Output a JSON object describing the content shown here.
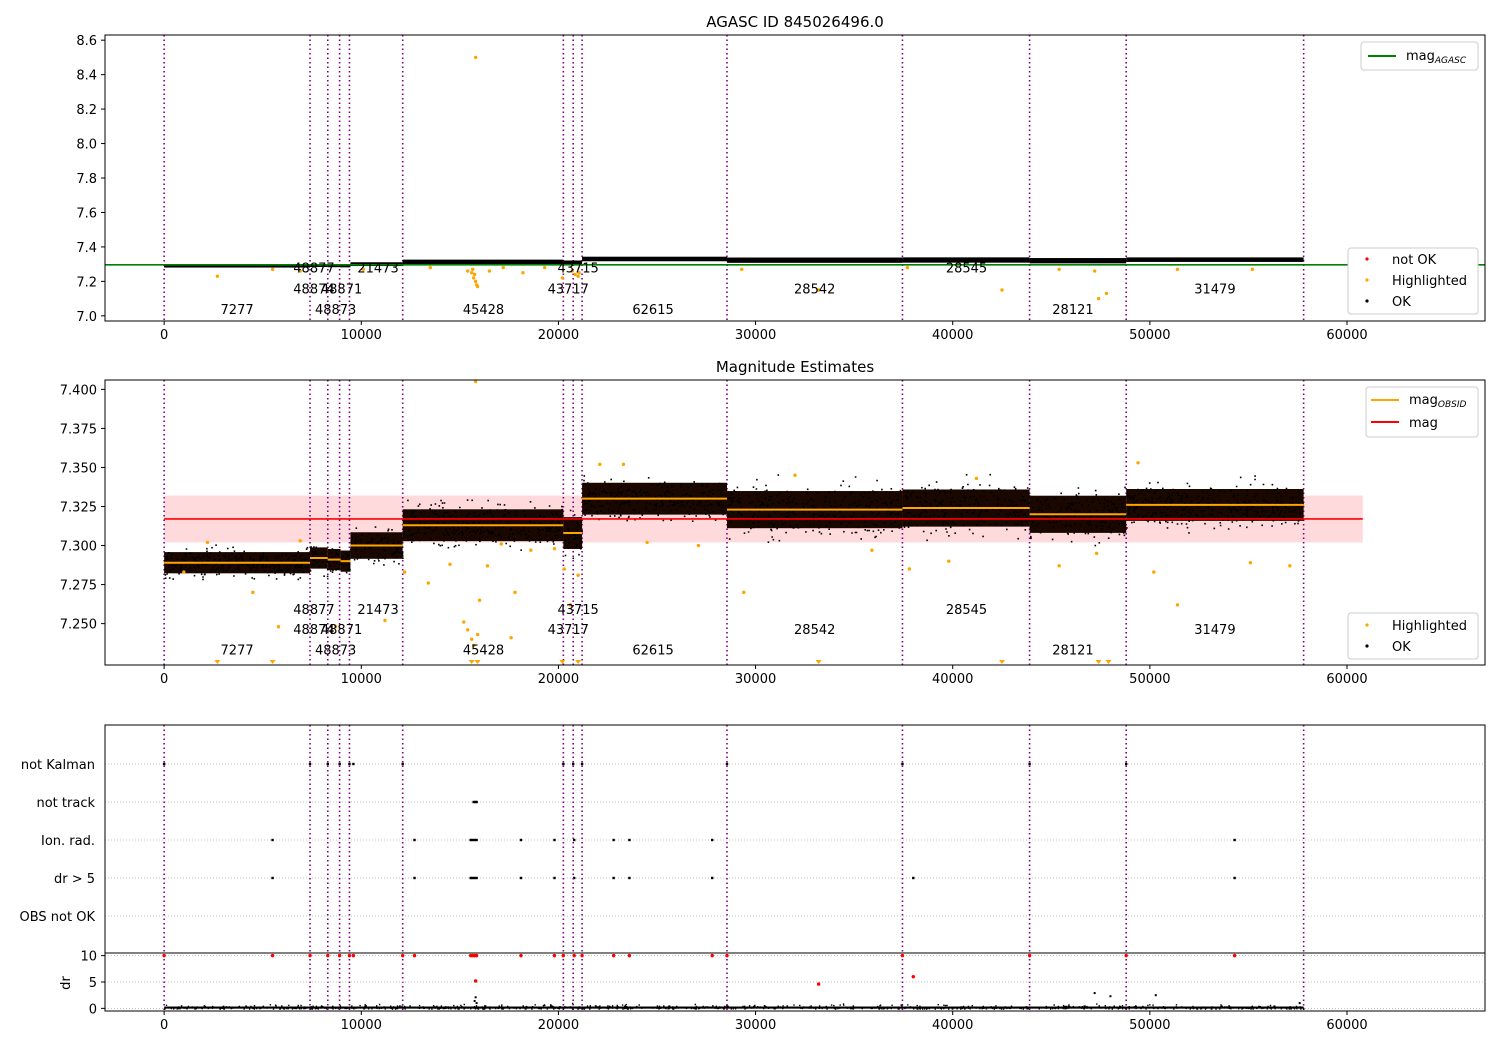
{
  "chart_data": [
    {
      "type": "scatter",
      "title": "AGASC ID 845026496.0",
      "xlim": [
        -3000,
        67000
      ],
      "ylim": [
        6.97,
        8.63
      ],
      "xticks": [
        0,
        10000,
        20000,
        30000,
        40000,
        50000,
        60000
      ],
      "xtick_labels": [
        "0",
        "10000",
        "20000",
        "30000",
        "40000",
        "50000",
        "60000"
      ],
      "yticks": [
        7.0,
        7.2,
        7.4,
        7.6,
        7.8,
        8.0,
        8.2,
        8.4,
        8.6
      ],
      "ytick_labels": [
        "7.0",
        "7.2",
        "7.4",
        "7.6",
        "7.8",
        "8.0",
        "8.2",
        "8.4",
        "8.6"
      ],
      "hline": {
        "y": 7.296,
        "color": "#008000",
        "label_main": "mag",
        "label_sub": "AGASC"
      },
      "segments": [
        {
          "x0": 0,
          "x1": 7400,
          "mag": 7.289,
          "spread": 0.004
        },
        {
          "x0": 7400,
          "x1": 8300,
          "mag": 7.292,
          "spread": 0.004
        },
        {
          "x0": 8300,
          "x1": 8950,
          "mag": 7.291,
          "spread": 0.004
        },
        {
          "x0": 8950,
          "x1": 9450,
          "mag": 7.29,
          "spread": 0.004
        },
        {
          "x0": 9450,
          "x1": 12100,
          "mag": 7.3,
          "spread": 0.005
        },
        {
          "x0": 12100,
          "x1": 20250,
          "mag": 7.313,
          "spread": 0.006
        },
        {
          "x0": 20250,
          "x1": 21200,
          "mag": 7.308,
          "spread": 0.006
        },
        {
          "x0": 21200,
          "x1": 28550,
          "mag": 7.33,
          "spread": 0.006
        },
        {
          "x0": 28550,
          "x1": 37450,
          "mag": 7.323,
          "spread": 0.007
        },
        {
          "x0": 37450,
          "x1": 43900,
          "mag": 7.324,
          "spread": 0.007
        },
        {
          "x0": 43900,
          "x1": 48800,
          "mag": 7.32,
          "spread": 0.007
        },
        {
          "x0": 48800,
          "x1": 57800,
          "mag": 7.326,
          "spread": 0.006
        }
      ],
      "vlines": [
        0,
        7400,
        8300,
        8900,
        9400,
        12100,
        20250,
        20750,
        21200,
        28550,
        37450,
        43900,
        48800,
        57800
      ],
      "obsid_labels": [
        {
          "x": 3700,
          "y": 7.04,
          "text": "7277"
        },
        {
          "x": 7600,
          "y": 7.16,
          "text": "48874"
        },
        {
          "x": 7600,
          "y": 7.28,
          "text": "48877"
        },
        {
          "x": 8700,
          "y": 7.04,
          "text": "48873"
        },
        {
          "x": 9000,
          "y": 7.16,
          "text": "48871"
        },
        {
          "x": 10850,
          "y": 7.28,
          "text": "21473"
        },
        {
          "x": 16200,
          "y": 7.04,
          "text": "45428"
        },
        {
          "x": 20500,
          "y": 7.16,
          "text": "43717"
        },
        {
          "x": 21000,
          "y": 7.28,
          "text": "43715"
        },
        {
          "x": 24800,
          "y": 7.04,
          "text": "62615"
        },
        {
          "x": 33000,
          "y": 7.16,
          "text": "28542"
        },
        {
          "x": 40700,
          "y": 7.28,
          "text": "28545"
        },
        {
          "x": 46100,
          "y": 7.04,
          "text": "28121"
        },
        {
          "x": 53300,
          "y": 7.16,
          "text": "31479"
        }
      ],
      "highlighted_points": [
        [
          2700,
          7.23
        ],
        [
          5500,
          7.27
        ],
        [
          6900,
          7.26
        ],
        [
          10100,
          7.27
        ],
        [
          13500,
          7.28
        ],
        [
          15400,
          7.26
        ],
        [
          15600,
          7.25
        ],
        [
          15700,
          7.22
        ],
        [
          15800,
          7.2
        ],
        [
          15850,
          7.18
        ],
        [
          15900,
          7.17
        ],
        [
          15750,
          7.24
        ],
        [
          15650,
          7.27
        ],
        [
          15800,
          8.5
        ],
        [
          16500,
          7.26
        ],
        [
          17200,
          7.28
        ],
        [
          18200,
          7.25
        ],
        [
          19300,
          7.28
        ],
        [
          20200,
          7.22
        ],
        [
          20700,
          7.26
        ],
        [
          20850,
          7.24
        ],
        [
          21000,
          7.23
        ],
        [
          21050,
          7.25
        ],
        [
          29300,
          7.27
        ],
        [
          33200,
          7.15
        ],
        [
          37700,
          7.28
        ],
        [
          42500,
          7.15
        ],
        [
          45400,
          7.27
        ],
        [
          47400,
          7.1
        ],
        [
          47800,
          7.13
        ],
        [
          47200,
          7.26
        ],
        [
          51400,
          7.27
        ],
        [
          55200,
          7.27
        ]
      ],
      "legend_line_position": "top-right",
      "legend_points_position": "lower-right",
      "legend_points": [
        "not OK",
        "Highlighted",
        "OK"
      ]
    },
    {
      "type": "scatter",
      "title": "Magnitude Estimates",
      "xlim": [
        -3000,
        67000
      ],
      "ylim": [
        7.2235,
        7.406
      ],
      "xticks": [
        0,
        10000,
        20000,
        30000,
        40000,
        50000,
        60000
      ],
      "xtick_labels": [
        "0",
        "10000",
        "20000",
        "30000",
        "40000",
        "50000",
        "60000"
      ],
      "yticks": [
        7.25,
        7.275,
        7.3,
        7.325,
        7.35,
        7.375,
        7.4
      ],
      "ytick_labels": [
        "7.250",
        "7.275",
        "7.300",
        "7.325",
        "7.350",
        "7.375",
        "7.400"
      ],
      "mag": {
        "y": 7.317,
        "band": [
          7.302,
          7.332
        ],
        "x0": 0,
        "x1": 60800,
        "color": "#ff0000",
        "label": "mag"
      },
      "obsid_line": {
        "color": "#ffa500",
        "label_main": "mag",
        "label_sub": "OBSID"
      },
      "obsid_labels": [
        {
          "x": 3700,
          "y": 7.2335,
          "text": "7277"
        },
        {
          "x": 7600,
          "y": 7.2465,
          "text": "48874"
        },
        {
          "x": 7600,
          "y": 7.2595,
          "text": "48877"
        },
        {
          "x": 8700,
          "y": 7.2335,
          "text": "48873"
        },
        {
          "x": 9000,
          "y": 7.2465,
          "text": "48871"
        },
        {
          "x": 10850,
          "y": 7.2595,
          "text": "21473"
        },
        {
          "x": 16200,
          "y": 7.2335,
          "text": "45428"
        },
        {
          "x": 20500,
          "y": 7.2465,
          "text": "43717"
        },
        {
          "x": 21000,
          "y": 7.2595,
          "text": "43715"
        },
        {
          "x": 24800,
          "y": 7.2335,
          "text": "62615"
        },
        {
          "x": 33000,
          "y": 7.2465,
          "text": "28542"
        },
        {
          "x": 40700,
          "y": 7.2595,
          "text": "28545"
        },
        {
          "x": 46100,
          "y": 7.2335,
          "text": "28121"
        },
        {
          "x": 53300,
          "y": 7.2465,
          "text": "31479"
        }
      ],
      "highlighted_points": [
        [
          1000,
          7.283
        ],
        [
          2200,
          7.302
        ],
        [
          4500,
          7.27
        ],
        [
          5800,
          7.248
        ],
        [
          6900,
          7.303
        ],
        [
          8700,
          7.248
        ],
        [
          11200,
          7.252
        ],
        [
          12200,
          7.283
        ],
        [
          13400,
          7.276
        ],
        [
          14500,
          7.288
        ],
        [
          15200,
          7.251
        ],
        [
          15400,
          7.246
        ],
        [
          15600,
          7.24
        ],
        [
          15700,
          7.236
        ],
        [
          15800,
          7.405
        ],
        [
          15900,
          7.243
        ],
        [
          16000,
          7.265
        ],
        [
          16400,
          7.287
        ],
        [
          17100,
          7.301
        ],
        [
          17800,
          7.27
        ],
        [
          17600,
          7.241
        ],
        [
          18600,
          7.297
        ],
        [
          19800,
          7.298
        ],
        [
          20300,
          7.285
        ],
        [
          20600,
          7.262
        ],
        [
          21000,
          7.281
        ],
        [
          22100,
          7.352
        ],
        [
          23300,
          7.352
        ],
        [
          24500,
          7.302
        ],
        [
          27100,
          7.3
        ],
        [
          29400,
          7.27
        ],
        [
          32000,
          7.345
        ],
        [
          35900,
          7.297
        ],
        [
          37800,
          7.285
        ],
        [
          39800,
          7.29
        ],
        [
          41200,
          7.343
        ],
        [
          45400,
          7.287
        ],
        [
          47300,
          7.295
        ],
        [
          49400,
          7.353
        ],
        [
          50200,
          7.283
        ],
        [
          51400,
          7.262
        ],
        [
          55100,
          7.289
        ],
        [
          57100,
          7.287
        ]
      ],
      "edge_markers_x": [
        2700,
        5500,
        15600,
        15900,
        20200,
        21000,
        33200,
        42500,
        47400,
        47900
      ],
      "legend_line_position": "top-right",
      "legend_points_position": "lower-right",
      "legend_points": [
        "Highlighted",
        "OK"
      ]
    },
    {
      "type": "scatter",
      "title": "",
      "xlim": [
        -3000,
        67000
      ],
      "xticks": [
        0,
        10000,
        20000,
        30000,
        40000,
        50000,
        60000
      ],
      "xtick_labels": [
        "0",
        "10000",
        "20000",
        "30000",
        "40000",
        "50000",
        "60000"
      ],
      "flag_rows": [
        "not Kalman",
        "not track",
        "Ion. rad.",
        "dr > 5",
        "OBS not OK"
      ],
      "flag_points": {
        "not Kalman": [
          0,
          7400,
          8300,
          8900,
          9400,
          9600,
          12100,
          20250,
          20750,
          21200,
          28550,
          37450,
          43900,
          48800
        ],
        "not track": [
          15700,
          15800,
          15850
        ],
        "Ion. rad.": [
          5500,
          12700,
          15550,
          15650,
          15750,
          15850,
          18100,
          19800,
          20800,
          22800,
          23600,
          27800,
          54300
        ],
        "dr > 5": [
          5500,
          12700,
          15550,
          15650,
          15750,
          15850,
          18100,
          19800,
          20800,
          22800,
          23600,
          27800,
          38000,
          54300
        ],
        "OBS not OK": []
      },
      "dr_ylabel": "dr",
      "dr_ylim": [
        -0.5,
        10.5
      ],
      "dr_yticks": [
        0,
        5,
        10
      ],
      "dr_ytick_labels": [
        "0",
        "5",
        "10"
      ],
      "dr_red_points": [
        [
          0,
          10
        ],
        [
          5500,
          10
        ],
        [
          7400,
          10
        ],
        [
          8300,
          10
        ],
        [
          8900,
          10
        ],
        [
          9400,
          10
        ],
        [
          9600,
          10
        ],
        [
          12100,
          10
        ],
        [
          12700,
          10
        ],
        [
          15550,
          10
        ],
        [
          15650,
          10
        ],
        [
          15750,
          10
        ],
        [
          15850,
          10
        ],
        [
          18100,
          10
        ],
        [
          19800,
          10
        ],
        [
          20250,
          10
        ],
        [
          20800,
          10
        ],
        [
          21200,
          10
        ],
        [
          22800,
          10
        ],
        [
          23600,
          10
        ],
        [
          27800,
          10
        ],
        [
          28550,
          10
        ],
        [
          37450,
          10
        ],
        [
          43900,
          10
        ],
        [
          48800,
          10
        ],
        [
          54300,
          10
        ],
        [
          15800,
          5.2
        ],
        [
          38000,
          6
        ],
        [
          33200,
          4.6
        ]
      ],
      "dr_black_points": [
        [
          15750,
          1.4
        ],
        [
          15800,
          2.1
        ],
        [
          15850,
          1.0
        ],
        [
          47200,
          2.9
        ],
        [
          48000,
          2.3
        ],
        [
          50300,
          2.5
        ],
        [
          57600,
          1.0
        ]
      ]
    }
  ]
}
